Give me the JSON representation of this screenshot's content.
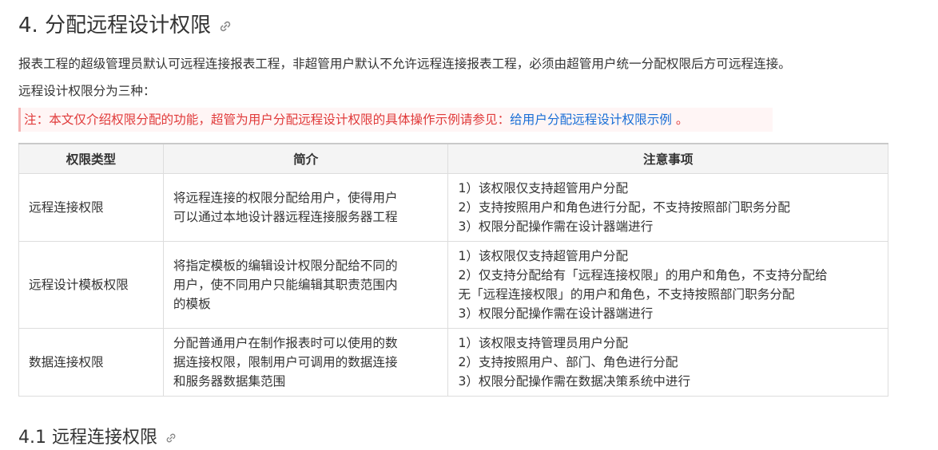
{
  "heading": {
    "title": "4. 分配远程设计权限",
    "link_icon": "link-icon"
  },
  "paragraphs": [
    "报表工程的超级管理员默认可远程连接报表工程，非超管用户默认不允许远程连接报表工程，必须由超管用户统一分配权限后方可远程连接。",
    "远程设计权限分为三种："
  ],
  "note": {
    "text": "注：本文仅介绍权限分配的功能，超管为用户分配远程设计权限的具体操作示例请参见：",
    "link_text": "给用户分配远程设计权限示例",
    "suffix": " 。"
  },
  "table": {
    "headers": [
      "权限类型",
      "简介",
      "注意事项"
    ],
    "rows": [
      {
        "type": "远程连接权限",
        "desc": [
          "将远程连接的权限分配给用户，使得用户",
          "可以通过本地设计器远程连接服务器工程"
        ],
        "notes": [
          "1）该权限仅支持超管用户分配",
          "2）支持按照用户和角色进行分配，不支持按照部门职务分配",
          "3）权限分配操作需在设计器端进行"
        ]
      },
      {
        "type": "远程设计模板权限",
        "desc": [
          "将指定模板的编辑设计权限分配给不同的",
          "用户，使不同用户只能编辑其职责范围内",
          "的模板"
        ],
        "notes": [
          "1）该权限仅支持超管用户分配",
          "2）仅支持分配给有「远程连接权限」的用户和角色，不支持分配给",
          "无「远程连接权限」的用户和角色，不支持按照部门职务分配",
          "3）权限分配操作需在设计器端进行"
        ]
      },
      {
        "type": "数据连接权限",
        "desc": [
          "分配普通用户在制作报表时可以使用的数",
          "据连接权限，限制用户可调用的数据连接",
          "和服务器数据集范围"
        ],
        "notes": [
          "1）该权限支持管理员用户分配",
          "2）支持按照用户、部门、角色进行分配",
          "3）权限分配操作需在数据决策系统中进行"
        ]
      }
    ]
  },
  "subheading": {
    "title": "4.1 远程连接权限",
    "link_icon": "link-icon"
  },
  "colors": {
    "text": "#333333",
    "note_text": "#e03a3a",
    "note_bg": "#fff5f5",
    "link": "#1a6fd6",
    "table_header_bg": "#f4f4f4",
    "border": "#dddddd"
  }
}
